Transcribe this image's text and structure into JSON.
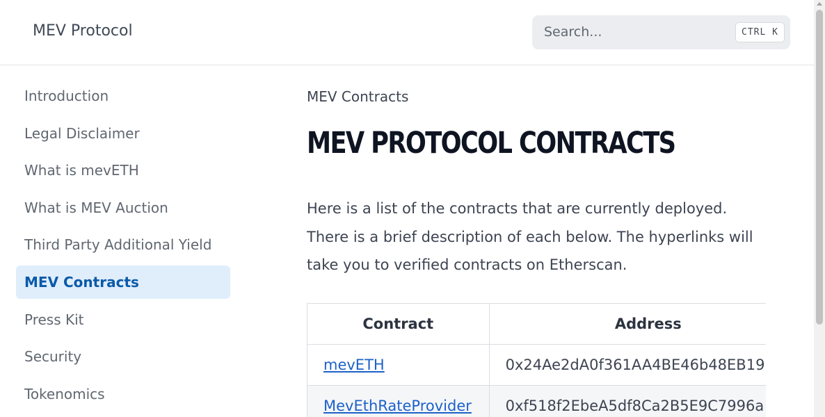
{
  "header": {
    "brand": "MEV Protocol",
    "search": {
      "placeholder": "Search...",
      "shortcut": "CTRL K"
    }
  },
  "sidebar": {
    "items": [
      {
        "label": "Introduction",
        "active": false
      },
      {
        "label": "Legal Disclaimer",
        "active": false
      },
      {
        "label": "What is mevETH",
        "active": false
      },
      {
        "label": "What is MEV Auction",
        "active": false
      },
      {
        "label": "Third Party Additional Yield",
        "active": false
      },
      {
        "label": "MEV Contracts",
        "active": true
      },
      {
        "label": "Press Kit",
        "active": false
      },
      {
        "label": "Security",
        "active": false
      },
      {
        "label": "Tokenomics",
        "active": false
      }
    ]
  },
  "main": {
    "breadcrumb": "MEV Contracts",
    "title": "MEV Protocol Contracts",
    "intro": "Here is a list of the contracts that are currently deployed. There is a brief description of each below. The hyperlinks will take you to verified contracts on Etherscan.",
    "table": {
      "headers": [
        "Contract",
        "Address"
      ],
      "rows": [
        {
          "contract": "mevETH",
          "address": "0x24Ae2dA0f361AA4BE46b48EB19"
        },
        {
          "contract": "MevEthRateProvider",
          "address": "0xf518f2EbeA5df8Ca2B5E9C7996a"
        }
      ]
    }
  },
  "colors": {
    "accent": "#0b5aa8",
    "active_bg": "#e0eefc",
    "link": "#1b62c8"
  }
}
